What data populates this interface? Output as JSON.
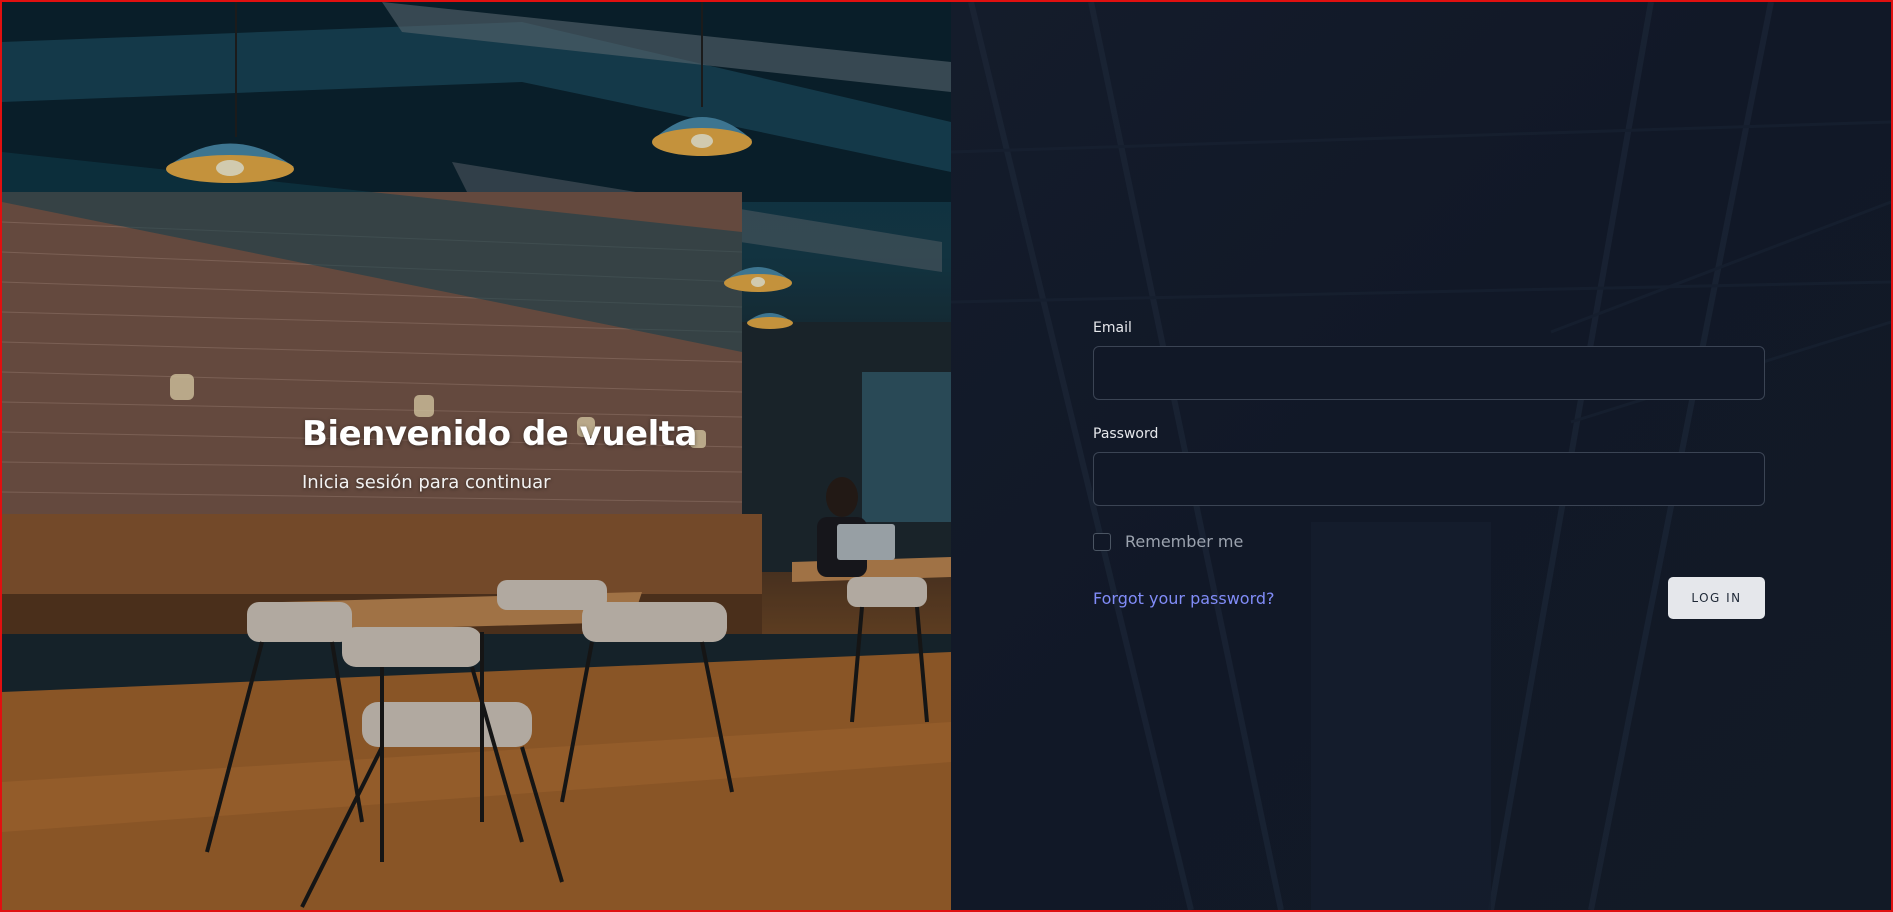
{
  "hero": {
    "title": "Bienvenido de vuelta",
    "subtitle": "Inicia sesión para continuar"
  },
  "login": {
    "email_label": "Email",
    "email_value": "",
    "password_label": "Password",
    "password_value": "",
    "remember_label": "Remember me",
    "remember_checked": false,
    "forgot_link": "Forgot your password?",
    "submit_label": "LOG IN"
  },
  "colors": {
    "panel_background": "#111827",
    "input_border": "#3b4454",
    "link": "#818cf8",
    "button_background": "#e5e7eb",
    "frame_border": "#e01010"
  }
}
